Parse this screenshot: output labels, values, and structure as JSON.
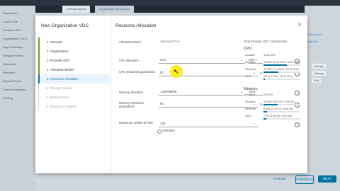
{
  "background": {
    "tabs": [
      "Getting Started",
      "Organization Resources"
    ],
    "sidebar": [
      "Datacenters",
      "Cloud Cells",
      "Provider VDCs",
      "Organization VDCs",
      "Edge Gateways",
      "Storage Policies",
      "Datastores",
      "Providers",
      "Network Pools",
      "External Networks",
      "Routing"
    ],
    "right_links": [
      "Add tenant",
      "Add new"
    ],
    "right_buttons": [
      "Storage",
      "Settings",
      "Edit"
    ]
  },
  "dialog": {
    "title": "New Organization VDC",
    "steps": [
      {
        "num": "1",
        "label": "General",
        "state": "done"
      },
      {
        "num": "2",
        "label": "Organization",
        "state": "done"
      },
      {
        "num": "3",
        "label": "Provider VDC",
        "state": "done"
      },
      {
        "num": "4",
        "label": "Allocation Model",
        "state": "done"
      },
      {
        "num": "5",
        "label": "Resource Allocation",
        "state": "active"
      },
      {
        "num": "6",
        "label": "Storage Policies",
        "state": "todo"
      },
      {
        "num": "7",
        "label": "Network Pool",
        "state": "todo"
      },
      {
        "num": "8",
        "label": "Ready to Complete",
        "state": "todo"
      }
    ],
    "section_title": "Resource Allocation",
    "close_icon": "close-icon",
    "form": {
      "allocation_model_label": "Allocation Model",
      "allocation_model_value": "Allocation Pool",
      "cpu_allocation_label": "CPU allocation",
      "cpu_allocation_value": "3.07",
      "cpu_allocation_unit": "GHz",
      "cpu_guaranteed_label": "CPU resources guaranteed",
      "cpu_guaranteed_value": "50",
      "memory_allocation_label": "Memory allocation",
      "memory_allocation_value": "1.92708/625",
      "memory_allocation_unit": "GB",
      "memory_guaranteed_label": "Memory resources guaranteed",
      "memory_guaranteed_value": "50",
      "max_vms_label": "Maximum number of VMs",
      "max_vms_value": "100",
      "unlimited_label": "Unlimited",
      "percent_sign": "%"
    },
    "provider_panel": {
      "title": "Total Provider VDC Consumption",
      "cpu_heading": "CPU",
      "cpu_rows": [
        {
          "label": "Available",
          "value": "18.32 GHz"
        },
        {
          "label": "Allocated",
          "value": "62.84% (11.51 GHz / 18.32 GHz)",
          "fill": 0.6284
        },
        {
          "label": "Reserved",
          "value": "39.78% (7.29 GHz / 18.32 GHz)",
          "fill": 0.3978
        },
        {
          "label": "Used",
          "value": "4% (0.7 GHz / 18.32 GHz)",
          "fill": 0.04
        }
      ],
      "memory_heading": "Memory",
      "memory_rows": [
        {
          "label": "Available",
          "value": "8.96 GB"
        },
        {
          "label": "Allocated",
          "value": "39.33% (3.52 GB / 8.96 GB)",
          "fill": 0.3933
        },
        {
          "label": "Reserved",
          "value": "8.82% (0.79 GB / 8.96 GB)",
          "fill": 0.0882
        },
        {
          "label": "Used",
          "value": "7.6% (0.68 GB / 8.96 GB)",
          "fill": 0.076
        }
      ]
    },
    "buttons": {
      "cancel": "CANCEL",
      "previous": "PREVIOUS",
      "next": "NEXT"
    }
  },
  "colors": {
    "accent": "#0072a3",
    "done": "#62a420",
    "cursor_highlight": "#ffe600"
  }
}
